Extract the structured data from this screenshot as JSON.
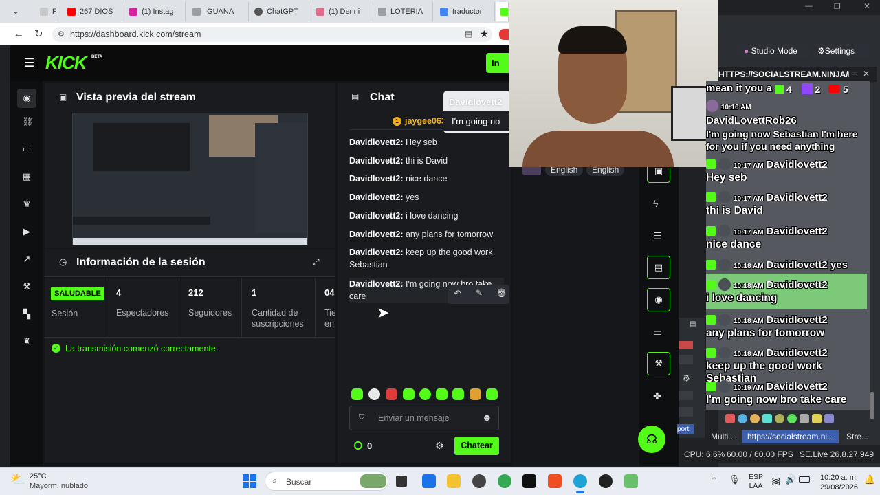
{
  "browser": {
    "tabs": [
      {
        "label": "P",
        "color": "#c9c9c9"
      },
      {
        "label": "267 DIOS",
        "color": "#ff0000"
      },
      {
        "label": "(1) Instag",
        "color": "#d6249f"
      },
      {
        "label": "IGUANA",
        "color": "#9aa0a6"
      },
      {
        "label": "ChatGPT",
        "color": "#555555"
      },
      {
        "label": "(1) Denni",
        "color": "#e06c8c"
      },
      {
        "label": "LOTERIA",
        "color": "#9aa0a6"
      },
      {
        "label": "traductor",
        "color": "#4285f4"
      }
    ],
    "url": "https://dashboard.kick.com/stream"
  },
  "kick": {
    "logo": "KICK",
    "beta": "BETA",
    "header_button": "In",
    "preview": {
      "title": "Vista previa del stream"
    },
    "session": {
      "title": "Información de la sesión",
      "health_badge": "SALUDABLE",
      "health_label": "Sesión",
      "stats": [
        {
          "value": "4",
          "label": "Espectadores"
        },
        {
          "value": "212",
          "label": "Seguidores"
        },
        {
          "value": "1",
          "label": "Cantidad de suscripciones"
        },
        {
          "value": "04",
          "label": "Tie en"
        }
      ],
      "status": "La transmisión comenzó correctamente."
    },
    "chat": {
      "title": "Chat",
      "pinned_user": "jaygee063",
      "messages": [
        {
          "user": "Davidlovett2:",
          "text": "Hey seb"
        },
        {
          "user": "Davidlovett2:",
          "text": "thi is David"
        },
        {
          "user": "Davidlovett2:",
          "text": "nice dance"
        },
        {
          "user": "Davidlovett2:",
          "text": "yes"
        },
        {
          "user": "Davidlovett2:",
          "text": "i love dancing"
        },
        {
          "user": "Davidlovett2:",
          "text": "any plans for tomorrow"
        },
        {
          "user": "Davidlovett2:",
          "text": "keep up the good work Sebastian"
        },
        {
          "user": "Davidlovett2:",
          "text": "I'm going now bro take care"
        }
      ],
      "popup_user": "Davidlovett2",
      "popup_text": "I'm going no",
      "input_placeholder": "Enviar un mensaje",
      "points": "0",
      "send_button": "Chatear"
    },
    "languages": [
      "English",
      "English"
    ]
  },
  "overlay": {
    "studio_mode": "Studio Mode",
    "settings": "Settings",
    "url_title": "HTTPS://SOCIALSTREAM.NINJA/DOC...",
    "partial_line": "mean it you a",
    "counts": {
      "kick": "4",
      "twitch": "2",
      "youtube": "5"
    },
    "messages": [
      {
        "time": "10:16 AM",
        "user": "DavidLovettRob26",
        "text": "I'm going now Sebastian I'm here for you if you need anything"
      },
      {
        "time": "10:17 AM",
        "user": "Davidlovett2",
        "text": "Hey seb"
      },
      {
        "time": "10:17 AM",
        "user": "Davidlovett2",
        "text": "thi is David"
      },
      {
        "time": "10:17 AM",
        "user": "Davidlovett2",
        "text": "nice dance"
      },
      {
        "time": "10:18 AM",
        "user": "Davidlovett2",
        "text": "yes"
      },
      {
        "time": "10:18 AM",
        "user": "Davidlovett2",
        "text": "i love dancing"
      },
      {
        "time": "10:18 AM",
        "user": "Davidlovett2",
        "text": "any plans for tomorrow"
      },
      {
        "time": "10:18 AM",
        "user": "Davidlovett2",
        "text": "keep up the good work Sebastian"
      },
      {
        "time": "10:19 AM",
        "user": "Davidlovett2",
        "text": "I'm going now bro take care"
      }
    ],
    "support": "port",
    "bottom_tabs": [
      "Multi...",
      "https://socialstream.ni...",
      "Stre..."
    ],
    "status": {
      "cpu": "CPU: 6.6%",
      "fps": "60.00 / 60.00 FPS",
      "version": "SE.Live 26.8.27.949"
    }
  },
  "taskbar": {
    "weather_temp": "25°C",
    "weather_desc": "Mayorm. nublado",
    "search": "Buscar",
    "lang1": "ESP",
    "lang2": "LAA",
    "time": "10:20 a. m.",
    "date": "29/08/2026"
  }
}
